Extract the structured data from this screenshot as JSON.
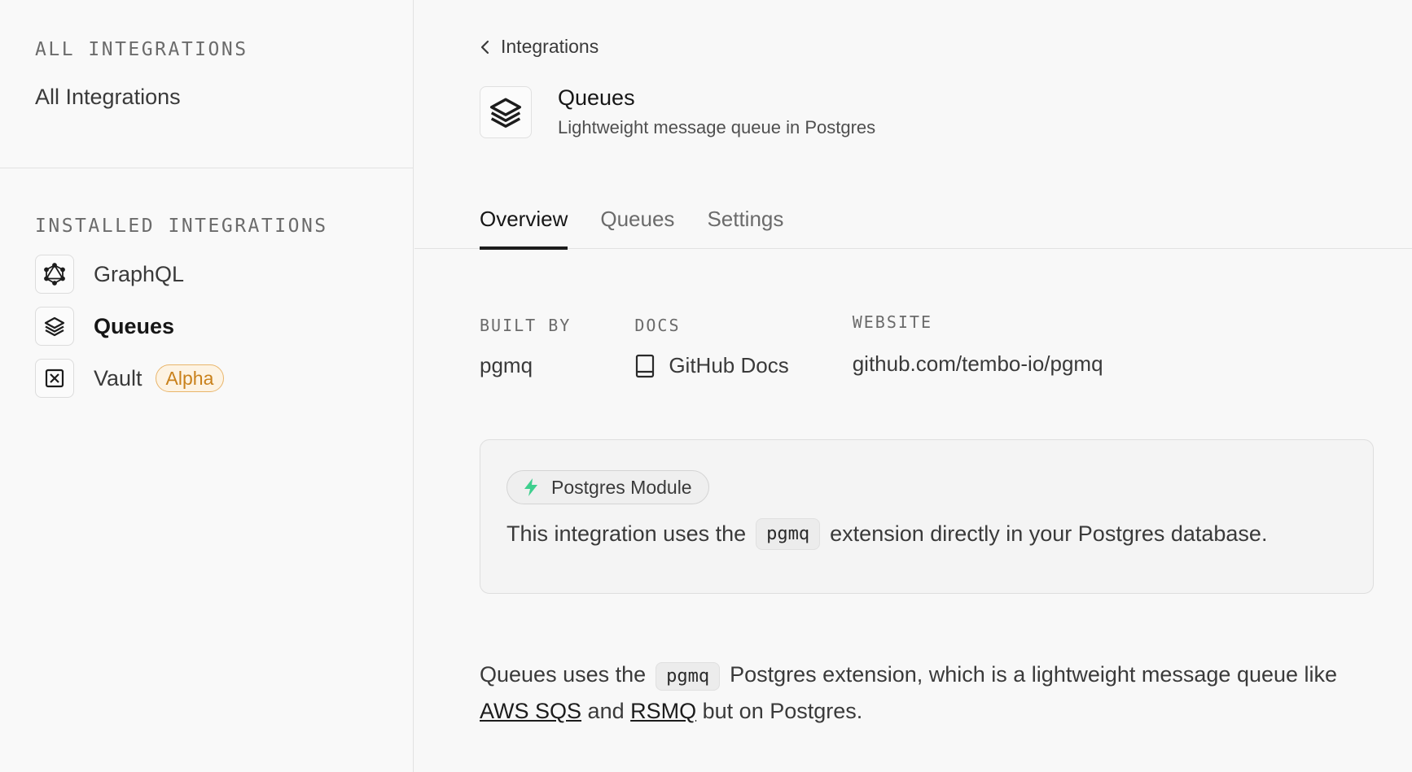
{
  "sidebar": {
    "all_heading": "ALL INTEGRATIONS",
    "all_link": "All Integrations",
    "installed_heading": "INSTALLED INTEGRATIONS",
    "items": [
      {
        "label": "GraphQL",
        "icon": "graphql-icon"
      },
      {
        "label": "Queues",
        "icon": "layers-icon",
        "active": true
      },
      {
        "label": "Vault",
        "icon": "vault-icon",
        "badge": "Alpha"
      }
    ]
  },
  "breadcrumb": {
    "label": "Integrations",
    "icon": "chevron-left-icon"
  },
  "header": {
    "title": "Queues",
    "subtitle": "Lightweight message queue in Postgres",
    "icon": "layers-icon"
  },
  "tabs": [
    "Overview",
    "Queues",
    "Settings"
  ],
  "meta": {
    "built_by_label": "BUILT BY",
    "built_by_value": "pgmq",
    "docs_label": "DOCS",
    "docs_value": "GitHub Docs",
    "website_label": "WEBSITE",
    "website_value": "github.com/tembo-io/pgmq"
  },
  "module": {
    "pill_label": "Postgres Module",
    "desc_before": "This integration uses the",
    "desc_code": "pgmq",
    "desc_after": "extension directly in your Postgres database."
  },
  "description": {
    "part1": "Queues uses the",
    "code": "pgmq",
    "part2": "Postgres extension, which is a lightweight message queue like",
    "link1": "AWS SQS",
    "and": "and",
    "link2": "RSMQ",
    "part3": "but on Postgres."
  },
  "colors": {
    "accent_badge": "#c9811b",
    "module_bolt": "#3ecf8e",
    "text": "#3a3a3a"
  }
}
